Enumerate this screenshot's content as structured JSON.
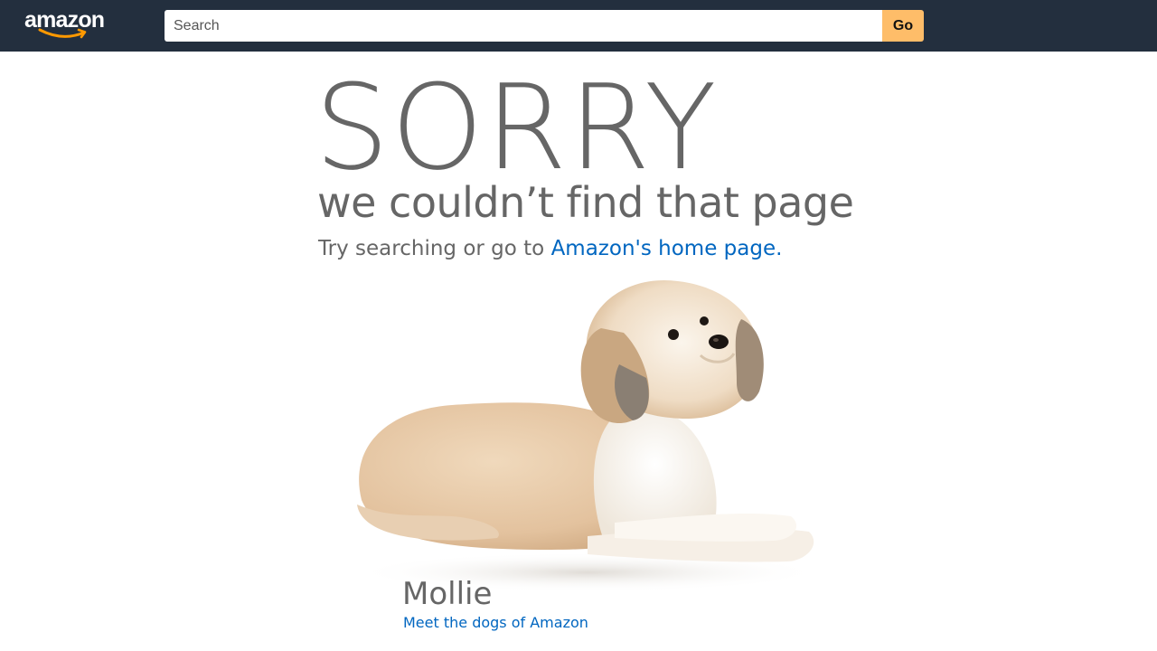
{
  "header": {
    "logo_text": "amazon",
    "search": {
      "placeholder": "Search",
      "value": ""
    },
    "go_label": "Go"
  },
  "main": {
    "heading": "SORRY",
    "subheading": "we couldn’t find that page",
    "try_text": "Try searching or go to ",
    "home_link": "Amazon's home page",
    "try_end": ".",
    "dog": {
      "name": "Mollie",
      "link": "Meet the dogs of Amazon"
    }
  },
  "colors": {
    "nav_bg": "#232f3e",
    "go_button": "#febd69",
    "link": "#0066c0",
    "text_gray": "#666666",
    "logo_smile": "#ff9900"
  }
}
